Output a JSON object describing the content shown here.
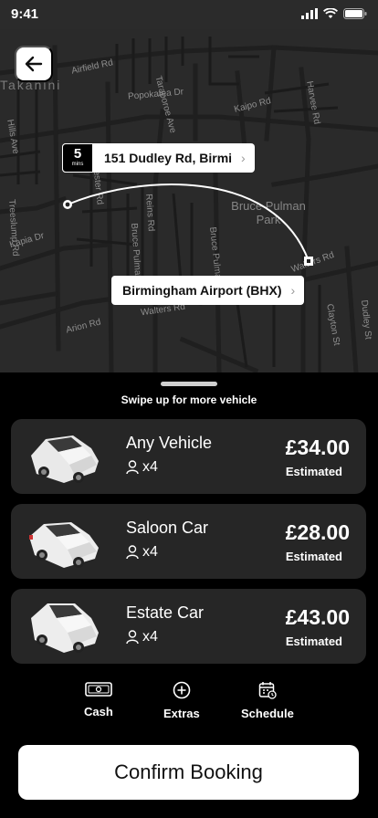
{
  "status_bar": {
    "time": "9:41"
  },
  "map": {
    "labels": {
      "suburb": "Takanini",
      "airfield": "Airfield Rd",
      "taraporoe": "Taraporoe Ave",
      "popokatea": "Popokatea Dr",
      "kaipo": "Kaipo Rd",
      "harvee": "Harvee Rd",
      "hills": "Hills Ave",
      "porchester": "Porchester Rd",
      "treeslump": "Treeslump Rd",
      "kapia": "Kapia Dr",
      "pulman_park": "Bruce Pulman Park",
      "reins": "Reins Rd",
      "bruce_pulman": "Bruce Pulman Dr",
      "walters_e": "Walters Rd",
      "walters_w": "Walters Rd",
      "arion": "Arion Rd",
      "clayton": "Clayton St",
      "dudley": "Dudley St"
    },
    "pickup": {
      "eta_value": "5",
      "eta_unit": "mins",
      "address": "151 Dudley Rd, Birmi"
    },
    "dropoff": {
      "address": "Birmingham Airport (BHX)"
    }
  },
  "sheet": {
    "swipe_hint": "Swipe up for more vehicle",
    "vehicles": [
      {
        "name": "Any Vehicle",
        "seats": "x4",
        "price": "£34.00",
        "price_note": "Estimated",
        "icon": "sedan-car-icon"
      },
      {
        "name": "Saloon Car",
        "seats": "x4",
        "price": "£28.00",
        "price_note": "Estimated",
        "icon": "saloon-car-icon"
      },
      {
        "name": "Estate Car",
        "seats": "x4",
        "price": "£43.00",
        "price_note": "Estimated",
        "icon": "estate-car-icon"
      }
    ],
    "actions": {
      "cash": "Cash",
      "extras": "Extras",
      "schedule": "Schedule"
    },
    "confirm_label": "Confirm Booking"
  },
  "colors": {
    "background": "#000000",
    "map_bg": "#2a2a2a",
    "card_bg": "#262626",
    "accent": "#ffffff"
  }
}
